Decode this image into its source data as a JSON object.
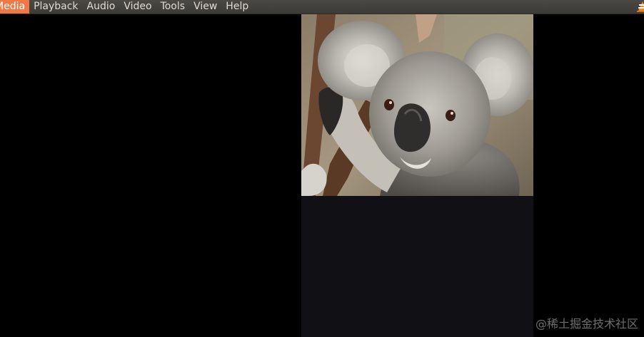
{
  "menubar": {
    "items": [
      {
        "label": "Media"
      },
      {
        "label": "Playback"
      },
      {
        "label": "Audio"
      },
      {
        "label": "Video"
      },
      {
        "label": "Tools"
      },
      {
        "label": "View"
      },
      {
        "label": "Help"
      }
    ],
    "app_icon": "vlc-cone-icon"
  },
  "video": {
    "frame_subject": "koala-photo"
  },
  "watermark": {
    "text": "@稀土掘金技术社区"
  },
  "colors": {
    "menubar_bg": "#3c3b37",
    "menu_text": "#dfdbd2",
    "video_bg": "#000000",
    "surface_bg": "#111014",
    "vlc_orange": "#f28c1f"
  }
}
